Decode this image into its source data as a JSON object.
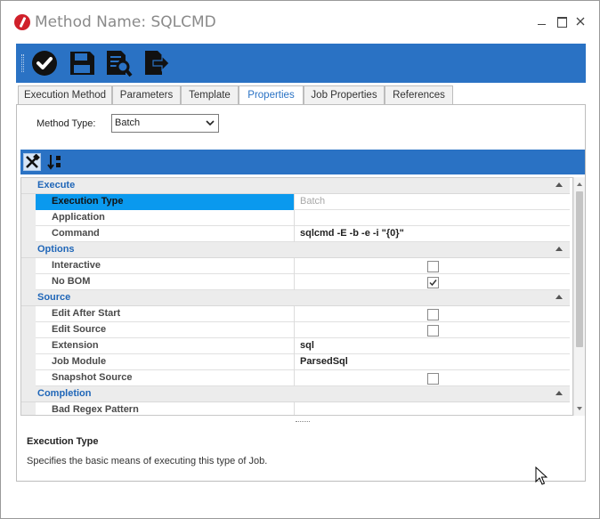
{
  "window": {
    "title": "Method Name: SQLCMD"
  },
  "toolbar": {
    "buttons": [
      "checkmark-icon",
      "save-icon",
      "preview-icon",
      "export-icon"
    ]
  },
  "tabs": [
    {
      "label": "Execution Method",
      "active": false
    },
    {
      "label": "Parameters",
      "active": false
    },
    {
      "label": "Template",
      "active": false
    },
    {
      "label": "Properties",
      "active": true
    },
    {
      "label": "Job Properties",
      "active": false
    },
    {
      "label": "References",
      "active": false
    }
  ],
  "method_type": {
    "label": "Method Type:",
    "value": "Batch"
  },
  "grid_toolbar": {
    "buttons": [
      "categorized-icon",
      "sort-alphabetical-icon"
    ]
  },
  "property_grid": {
    "categories": [
      {
        "label": "Execute",
        "properties": [
          {
            "name": "Execution Type",
            "value": "Batch",
            "kind": "readonly",
            "selected": true
          },
          {
            "name": "Application",
            "value": "",
            "kind": "text"
          },
          {
            "name": "Command",
            "value": "sqlcmd -E -b -e -i \"{0}\"",
            "kind": "text"
          }
        ]
      },
      {
        "label": "Options",
        "properties": [
          {
            "name": "Interactive",
            "checked": false,
            "kind": "checkbox"
          },
          {
            "name": "No BOM",
            "checked": true,
            "kind": "checkbox"
          }
        ]
      },
      {
        "label": "Source",
        "properties": [
          {
            "name": "Edit After Start",
            "checked": false,
            "kind": "checkbox"
          },
          {
            "name": "Edit Source",
            "checked": false,
            "kind": "checkbox"
          },
          {
            "name": "Extension",
            "value": "sql",
            "kind": "text"
          },
          {
            "name": "Job Module",
            "value": "ParsedSql",
            "kind": "text"
          },
          {
            "name": "Snapshot Source",
            "checked": false,
            "kind": "checkbox"
          }
        ]
      },
      {
        "label": "Completion",
        "properties": [
          {
            "name": "Bad Regex Pattern",
            "value": "",
            "kind": "text"
          }
        ]
      }
    ]
  },
  "description": {
    "title": "Execution Type",
    "text": "Specifies the basic means of executing this type of Job."
  },
  "colors": {
    "accent": "#2a72c4",
    "selection": "#0a99ee",
    "category_text": "#1f66b8"
  }
}
